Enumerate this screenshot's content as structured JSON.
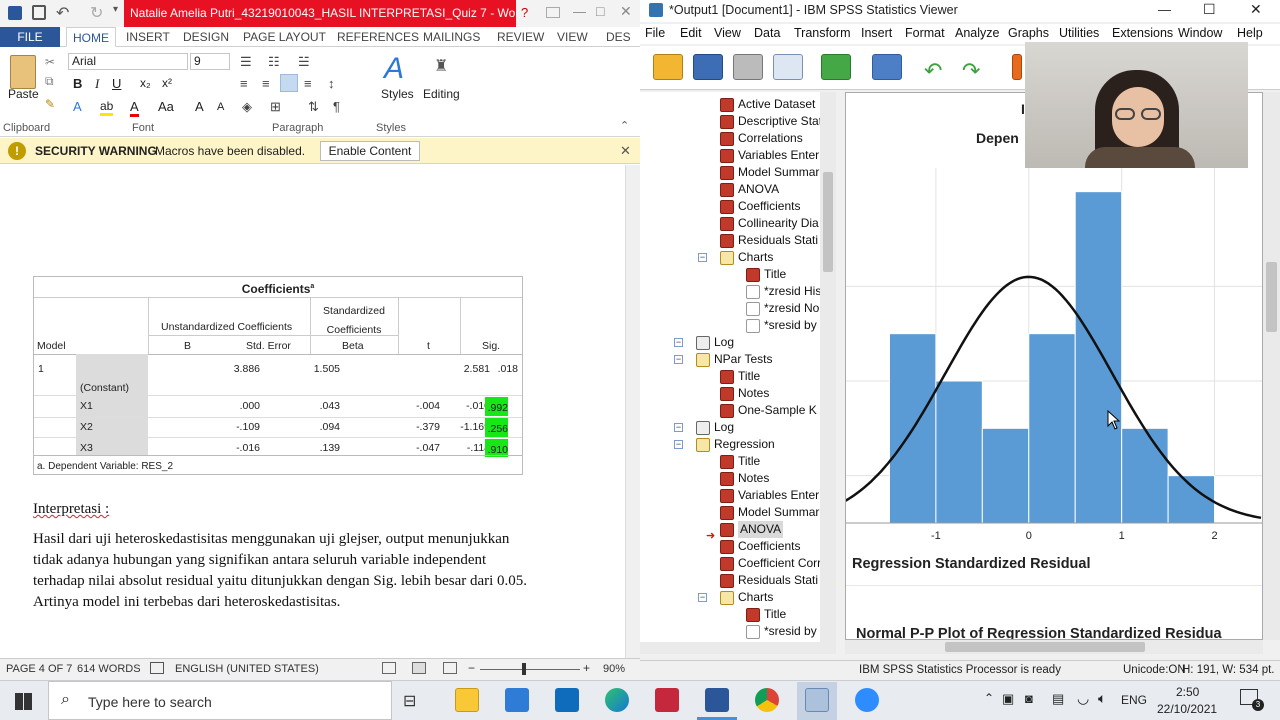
{
  "word": {
    "title": "Natalie Amelia Putri_43219010043_HASIL INTERPRETASI_Quiz 7 - Wo...",
    "title_buttons": [
      "?",
      "—",
      "□",
      "✕"
    ],
    "tabs": [
      "FILE",
      "HOME",
      "INSERT",
      "DESIGN",
      "PAGE LAYOUT",
      "REFERENCES",
      "MAILINGS",
      "REVIEW",
      "VIEW",
      "DES"
    ],
    "active_tab": "HOME",
    "ribbon": {
      "paste": "Paste",
      "font_name": "Arial",
      "font_size": "9",
      "styles": "Styles",
      "editing": "Editing",
      "groups": [
        "Clipboard",
        "Font",
        "Paragraph",
        "Styles"
      ]
    },
    "warning": {
      "title": "SECURITY WARNING",
      "message": "Macros have been disabled.",
      "button": "Enable Content"
    },
    "table": {
      "title": "Coefficients",
      "title_sup": "a",
      "h_unstd": "Unstandardized Coefficients",
      "h_std": "Standardized Coefficients",
      "h_model": "Model",
      "h_b": "B",
      "h_se": "Std. Error",
      "h_beta": "Beta",
      "h_t": "t",
      "h_sig": "Sig.",
      "model_num": "1",
      "rows": [
        {
          "name": "(Constant)",
          "b": "3.886",
          "se": "1.505",
          "beta": "",
          "t": "2.581",
          "sig": ".018",
          "hl": false
        },
        {
          "name": "X1",
          "b": ".000",
          "se": ".043",
          "beta": "-.004",
          "t": "-.010",
          "sig": ".992",
          "hl": true
        },
        {
          "name": "X2",
          "b": "-.109",
          "se": ".094",
          "beta": "-.379",
          "t": "-1.169",
          "sig": ".256",
          "hl": true
        },
        {
          "name": "X3",
          "b": "-.016",
          "se": ".139",
          "beta": "-.047",
          "t": "-.114",
          "sig": ".910",
          "hl": true
        }
      ],
      "footnote": "a. Dependent Variable: RES_2"
    },
    "interp_title": "Interpretasi :",
    "interp_lines": [
      "Hasil dari uji heteroskedastisitas menggunakan uji glejser, output menunjukkan",
      "tidak adanya hubungan yang signifikan antara seluruh variable independent",
      "terhadap nilai absolut residual yaitu ditunjukkan dengan Sig. lebih besar dari 0.05.",
      "Artinya model ini terbebas dari heteroskedastisitas."
    ],
    "status": {
      "page": "PAGE 4 OF 7",
      "words": "614 WORDS",
      "language": "ENGLISH (UNITED STATES)",
      "zoom": "90%"
    }
  },
  "spss": {
    "title": "*Output1 [Document1] - IBM SPSS Statistics Viewer",
    "menu": [
      "File",
      "Edit",
      "View",
      "Data",
      "Transform",
      "Insert",
      "Format",
      "Analyze",
      "Graphs",
      "Utilities",
      "Extensions",
      "Window",
      "Help"
    ],
    "tree": [
      {
        "label": "Active Dataset",
        "icon": "book",
        "x": 80,
        "y": 12
      },
      {
        "label": "Descriptive Stat",
        "icon": "book",
        "x": 80,
        "y": 29
      },
      {
        "label": "Correlations",
        "icon": "book",
        "x": 80,
        "y": 46
      },
      {
        "label": "Variables Enter",
        "icon": "book",
        "x": 80,
        "y": 63
      },
      {
        "label": "Model Summar",
        "icon": "book",
        "x": 80,
        "y": 80
      },
      {
        "label": "ANOVA",
        "icon": "book",
        "x": 80,
        "y": 97
      },
      {
        "label": "Coefficients",
        "icon": "book",
        "x": 80,
        "y": 114
      },
      {
        "label": "Collinearity Dia",
        "icon": "book",
        "x": 80,
        "y": 131
      },
      {
        "label": "Residuals Stati",
        "icon": "book",
        "x": 80,
        "y": 148
      },
      {
        "label": "Charts",
        "icon": "fold",
        "x": 80,
        "y": 165
      },
      {
        "label": "Title",
        "icon": "book",
        "x": 106,
        "y": 182
      },
      {
        "label": "*zresid His",
        "icon": "chart",
        "x": 106,
        "y": 199
      },
      {
        "label": "*zresid No",
        "icon": "chart",
        "x": 106,
        "y": 216
      },
      {
        "label": "*sresid by",
        "icon": "chart",
        "x": 106,
        "y": 233
      },
      {
        "label": "Log",
        "icon": "log",
        "x": 56,
        "y": 250
      },
      {
        "label": "NPar Tests",
        "icon": "fold",
        "x": 56,
        "y": 267
      },
      {
        "label": "Title",
        "icon": "book",
        "x": 80,
        "y": 284
      },
      {
        "label": "Notes",
        "icon": "book",
        "x": 80,
        "y": 301
      },
      {
        "label": "One-Sample K",
        "icon": "book",
        "x": 80,
        "y": 318
      },
      {
        "label": "Log",
        "icon": "log",
        "x": 56,
        "y": 335
      },
      {
        "label": "Regression",
        "icon": "fold",
        "x": 56,
        "y": 352
      },
      {
        "label": "Title",
        "icon": "book",
        "x": 80,
        "y": 369
      },
      {
        "label": "Notes",
        "icon": "book",
        "x": 80,
        "y": 386
      },
      {
        "label": "Variables Enter",
        "icon": "book",
        "x": 80,
        "y": 403
      },
      {
        "label": "Model Summar",
        "icon": "book",
        "x": 80,
        "y": 420
      },
      {
        "label": "ANOVA",
        "icon": "book",
        "x": 80,
        "y": 437,
        "selected": true
      },
      {
        "label": "Coefficients",
        "icon": "book",
        "x": 80,
        "y": 454
      },
      {
        "label": "Coefficient Corr",
        "icon": "book",
        "x": 80,
        "y": 471
      },
      {
        "label": "Residuals Stati",
        "icon": "book",
        "x": 80,
        "y": 488
      },
      {
        "label": "Charts",
        "icon": "fold",
        "x": 80,
        "y": 505
      },
      {
        "label": "Title",
        "icon": "book",
        "x": 106,
        "y": 522
      },
      {
        "label": "*sresid by",
        "icon": "chart",
        "x": 106,
        "y": 539
      }
    ],
    "output": {
      "heading_partial": "Depen",
      "heading_partial2": "I",
      "x_axis_title": "Regression Standardized Residual",
      "next_heading": "Normal P-P Plot of Regression Standardized Residua"
    },
    "status": {
      "processor": "IBM SPSS Statistics Processor is ready",
      "unicode": "Unicode:ON",
      "dims": "H: 191, W: 534 pt."
    }
  },
  "chart_data": {
    "type": "bar",
    "title": "",
    "xlabel": "Regression Standardized Residual",
    "ylabel": "",
    "x_ticks": [
      "-1",
      "0",
      "1",
      "2"
    ],
    "x_tick_values": [
      -1,
      0,
      1,
      2
    ],
    "xlim": [
      -2,
      2.5
    ],
    "ylim": [
      0,
      7.5
    ],
    "bin_width": 0.5,
    "bins": [
      {
        "start": -1.5,
        "count": 4
      },
      {
        "start": -1.0,
        "count": 3
      },
      {
        "start": -0.5,
        "count": 2
      },
      {
        "start": 0.0,
        "count": 4
      },
      {
        "start": 0.5,
        "count": 7
      },
      {
        "start": 1.0,
        "count": 2
      },
      {
        "start": 1.5,
        "count": 1
      }
    ],
    "normal_curve": {
      "mean": 0,
      "sd": 0.9,
      "peak": 5.2
    },
    "bar_color": "#5b9bd5"
  },
  "taskbar": {
    "search_placeholder": "Type here to search",
    "language": "ENG",
    "time": "2:50",
    "date": "22/10/2021",
    "notif_count": "3"
  }
}
